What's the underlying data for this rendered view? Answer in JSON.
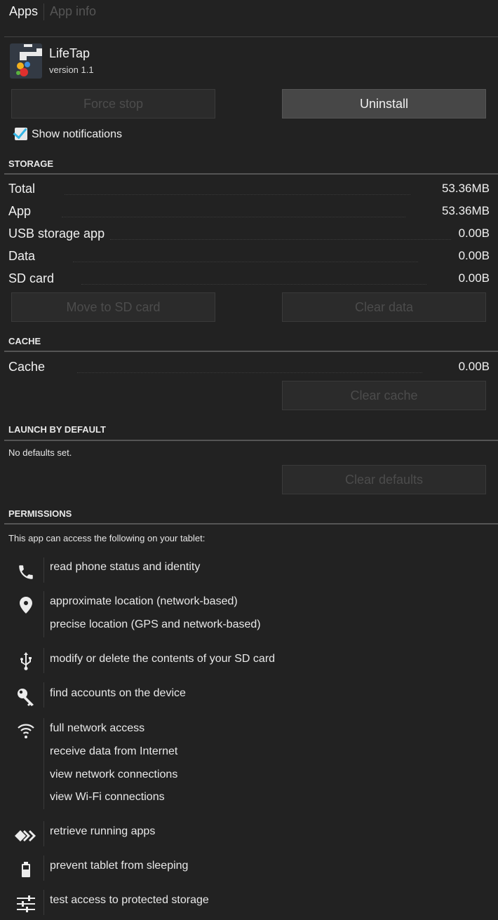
{
  "breadcrumb": {
    "root": "Apps",
    "current": "App info"
  },
  "app": {
    "name": "LifeTap",
    "version": "version 1.1"
  },
  "buttons": {
    "force_stop": "Force stop",
    "uninstall": "Uninstall",
    "move_to_sd": "Move to SD card",
    "clear_data": "Clear data",
    "clear_cache": "Clear cache",
    "clear_defaults": "Clear defaults"
  },
  "notifications": {
    "label": "Show notifications",
    "checked": true
  },
  "storage": {
    "heading": "STORAGE",
    "rows": [
      {
        "label": "Total",
        "value": "53.36MB"
      },
      {
        "label": "App",
        "value": "53.36MB"
      },
      {
        "label": "USB storage app",
        "value": "0.00B"
      },
      {
        "label": "Data",
        "value": "0.00B"
      },
      {
        "label": "SD card",
        "value": "0.00B"
      }
    ]
  },
  "cache": {
    "heading": "CACHE",
    "label": "Cache",
    "value": "0.00B"
  },
  "launch": {
    "heading": "LAUNCH BY DEFAULT",
    "text": "No defaults set."
  },
  "permissions": {
    "heading": "PERMISSIONS",
    "intro": "This app can access the following on your tablet:",
    "groups": [
      {
        "icon": "phone-icon",
        "items": [
          "read phone status and identity"
        ]
      },
      {
        "icon": "location-pin-icon",
        "items": [
          "approximate location (network-based)",
          "precise location (GPS and network-based)"
        ]
      },
      {
        "icon": "usb-icon",
        "items": [
          "modify or delete the contents of your SD card"
        ]
      },
      {
        "icon": "key-icon",
        "items": [
          "find accounts on the device"
        ]
      },
      {
        "icon": "wifi-icon",
        "items": [
          "full network access",
          "receive data from Internet",
          "view network connections",
          "view Wi-Fi connections"
        ]
      },
      {
        "icon": "running-apps-icon",
        "items": [
          "retrieve running apps"
        ]
      },
      {
        "icon": "battery-icon",
        "items": [
          "prevent tablet from sleeping"
        ]
      },
      {
        "icon": "sliders-icon",
        "items": [
          "test access to protected storage"
        ]
      }
    ]
  }
}
